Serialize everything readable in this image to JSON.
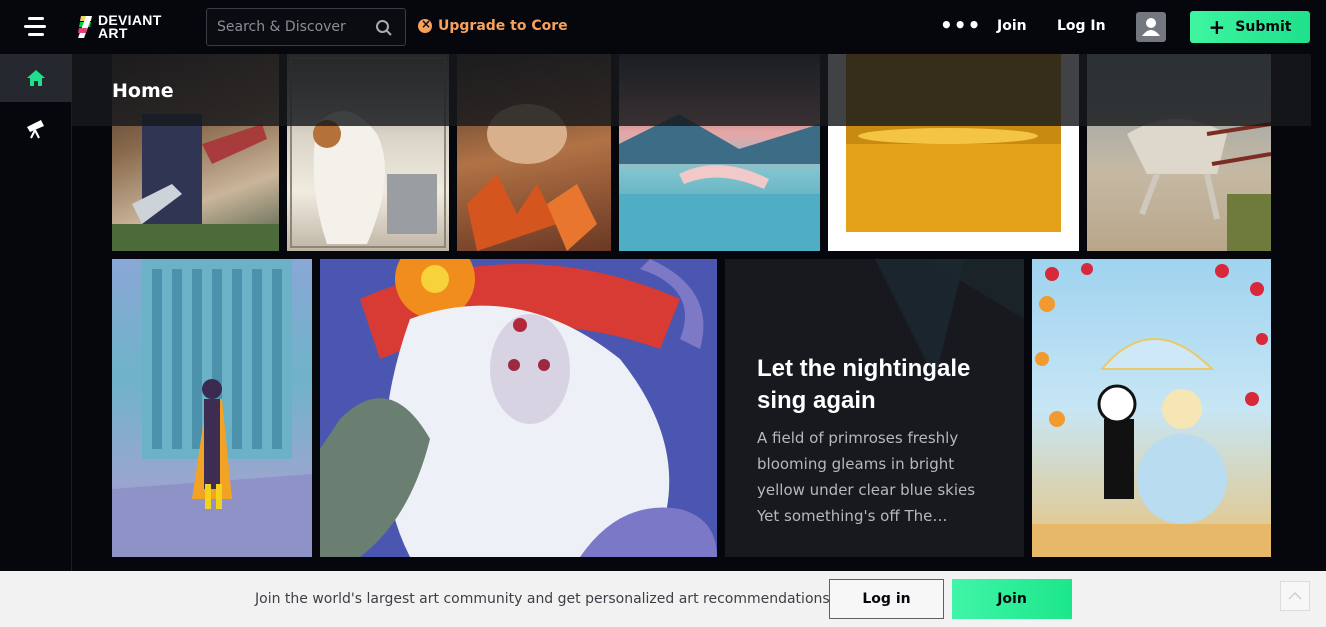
{
  "header": {
    "logo_line1": "DEVIANT",
    "logo_line2": "ART",
    "search_placeholder": "Search & Discover",
    "upgrade_label": "Upgrade to Core",
    "more_label": "•••",
    "join_label": "Join",
    "login_label": "Log In",
    "submit_label": "Submit"
  },
  "sidebar": {
    "items": [
      {
        "name": "home",
        "icon": "home-icon",
        "active": true
      },
      {
        "name": "watch",
        "icon": "telescope-icon",
        "active": false
      }
    ]
  },
  "main": {
    "page_title": "Home",
    "featured_text": {
      "title": "Let the nightingale sing again",
      "excerpt": "A field of primroses freshly blooming gleams in bright yellow under clear blue skies Yet something's off The…"
    }
  },
  "footer_banner": {
    "text": "Join the world's largest art community and get personalized art recommendations.",
    "login_label": "Log in",
    "join_label": "Join"
  },
  "colors": {
    "accent_green": "#1fe08c",
    "upgrade_orange": "#f7a15d",
    "background": "#06070d"
  }
}
